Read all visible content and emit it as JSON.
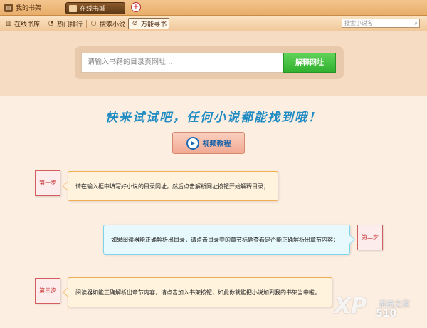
{
  "titlebar": {
    "mybooks_label": "我的书架",
    "store_tab_label": "在线书城",
    "new_tab_symbol": "+"
  },
  "toolbar": {
    "items": [
      {
        "label": "在线书库",
        "icon": "bookshelf-icon"
      },
      {
        "label": "热门排行",
        "icon": "hot-ranking-icon"
      },
      {
        "label": "搜索小说",
        "icon": "search-icon"
      },
      {
        "label": "万能寻书",
        "icon": "compass-icon"
      }
    ],
    "search_placeholder": "搜索小说名"
  },
  "url_parse": {
    "placeholder": "请输入书籍的目录页网址...",
    "button_label": "解释网址"
  },
  "slogan": "快来试试吧，任何小说都能找到哦！",
  "video_button_label": "视频教程",
  "steps": [
    {
      "badge": "第一步",
      "text": "请在输入框中填写好小说的目录网址，然后点击解析网址按钮开始解释目录；"
    },
    {
      "badge": "第二步",
      "text": "如果阅读器能正确解析出目录，请点击目录中的章节标题查看是否能正确解析出章节内容；"
    },
    {
      "badge": "第三步",
      "text": "阅读器如能正确解析出章节内容，请点击加入书架按钮，如此你就能把小说加到我的书架当中啦。"
    }
  ],
  "watermark": {
    "brand": "XP",
    "site_cn": "系统之家",
    "site_num": "510"
  },
  "colors": {
    "accent_green": "#31b02f",
    "slogan_blue": "#1e8bc3",
    "step_red": "#c62f2f"
  }
}
